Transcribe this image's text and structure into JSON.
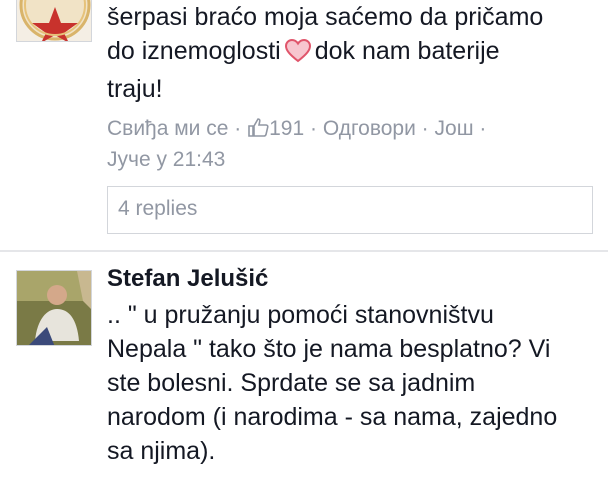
{
  "comments": [
    {
      "text_line1": "šerpasi braćo moja saćemo da pričamo",
      "text_line2a": "do iznemoglosti",
      "text_line2b": "dok nam baterije",
      "text_line3": "traju!",
      "meta": {
        "like": "Свиђа ми се",
        "sep1": " · ",
        "likes_count": "191",
        "sep2": " · ",
        "reply": "Одговори",
        "sep3": " · ",
        "more": "Још",
        "sep4": " ·",
        "timestamp": "Јуче у 21:43"
      },
      "replies": "4 replies",
      "avatar_icon": "star-emblem-icon",
      "heart_icon": "heart-icon"
    },
    {
      "author": "Stefan Jelušić",
      "lines": [
        ".. \" u pružanju pomoći stanovništvu",
        "Nepala \" tako što je nama besplatno? Vi",
        "ste bolesni. Sprdate se sa jadnim",
        "narodom (i narodima - sa nama, zajedno",
        "sa njima)."
      ],
      "avatar_icon": "user-photo-avatar"
    }
  ],
  "colors": {
    "text": "#141823",
    "meta": "#9197a3",
    "divider": "#e5e6e9",
    "heart": "#e0556b"
  }
}
